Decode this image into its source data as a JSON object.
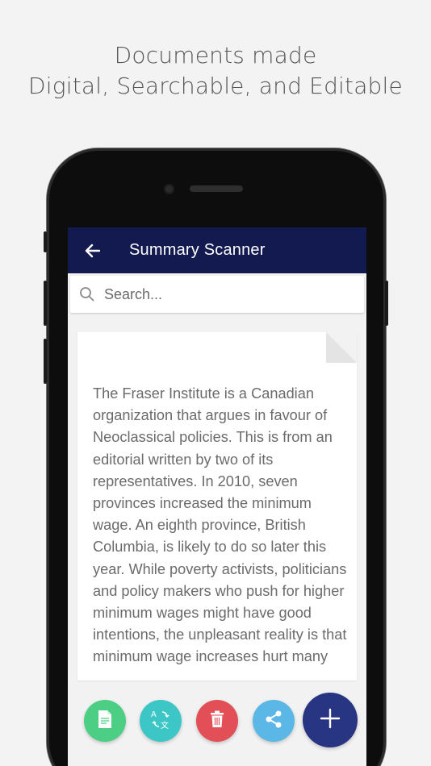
{
  "headline": {
    "line1": "Documents made",
    "line2": "Digital, Searchable, and Editable"
  },
  "app": {
    "title": "Summary Scanner",
    "back_icon": "back-arrow-icon"
  },
  "search": {
    "placeholder": "Search...",
    "value": ""
  },
  "document": {
    "text": "The Fraser Institute is a Canadian organization that argues in favour of Neoclassical policies. This is from an editorial written by two of its representatives. In 2010, seven provinces increased the minimum wage. An eighth province, British Columbia, is likely to do so later this year. While poverty activists, politicians and policy makers who push for higher minimum wages might have good intentions, the unpleasant reality is that minimum wage increases hurt many low-skilled workers."
  },
  "actions": [
    {
      "icon": "document-icon",
      "color": "#4ccf85"
    },
    {
      "icon": "translate-icon",
      "color": "#3cc6c6"
    },
    {
      "icon": "trash-icon",
      "color": "#e34f57"
    },
    {
      "icon": "share-icon",
      "color": "#5bb7e6"
    },
    {
      "icon": "plus-icon",
      "color": "#283582"
    }
  ],
  "colors": {
    "appbar": "#131a50",
    "background": "#f4f3f3"
  }
}
